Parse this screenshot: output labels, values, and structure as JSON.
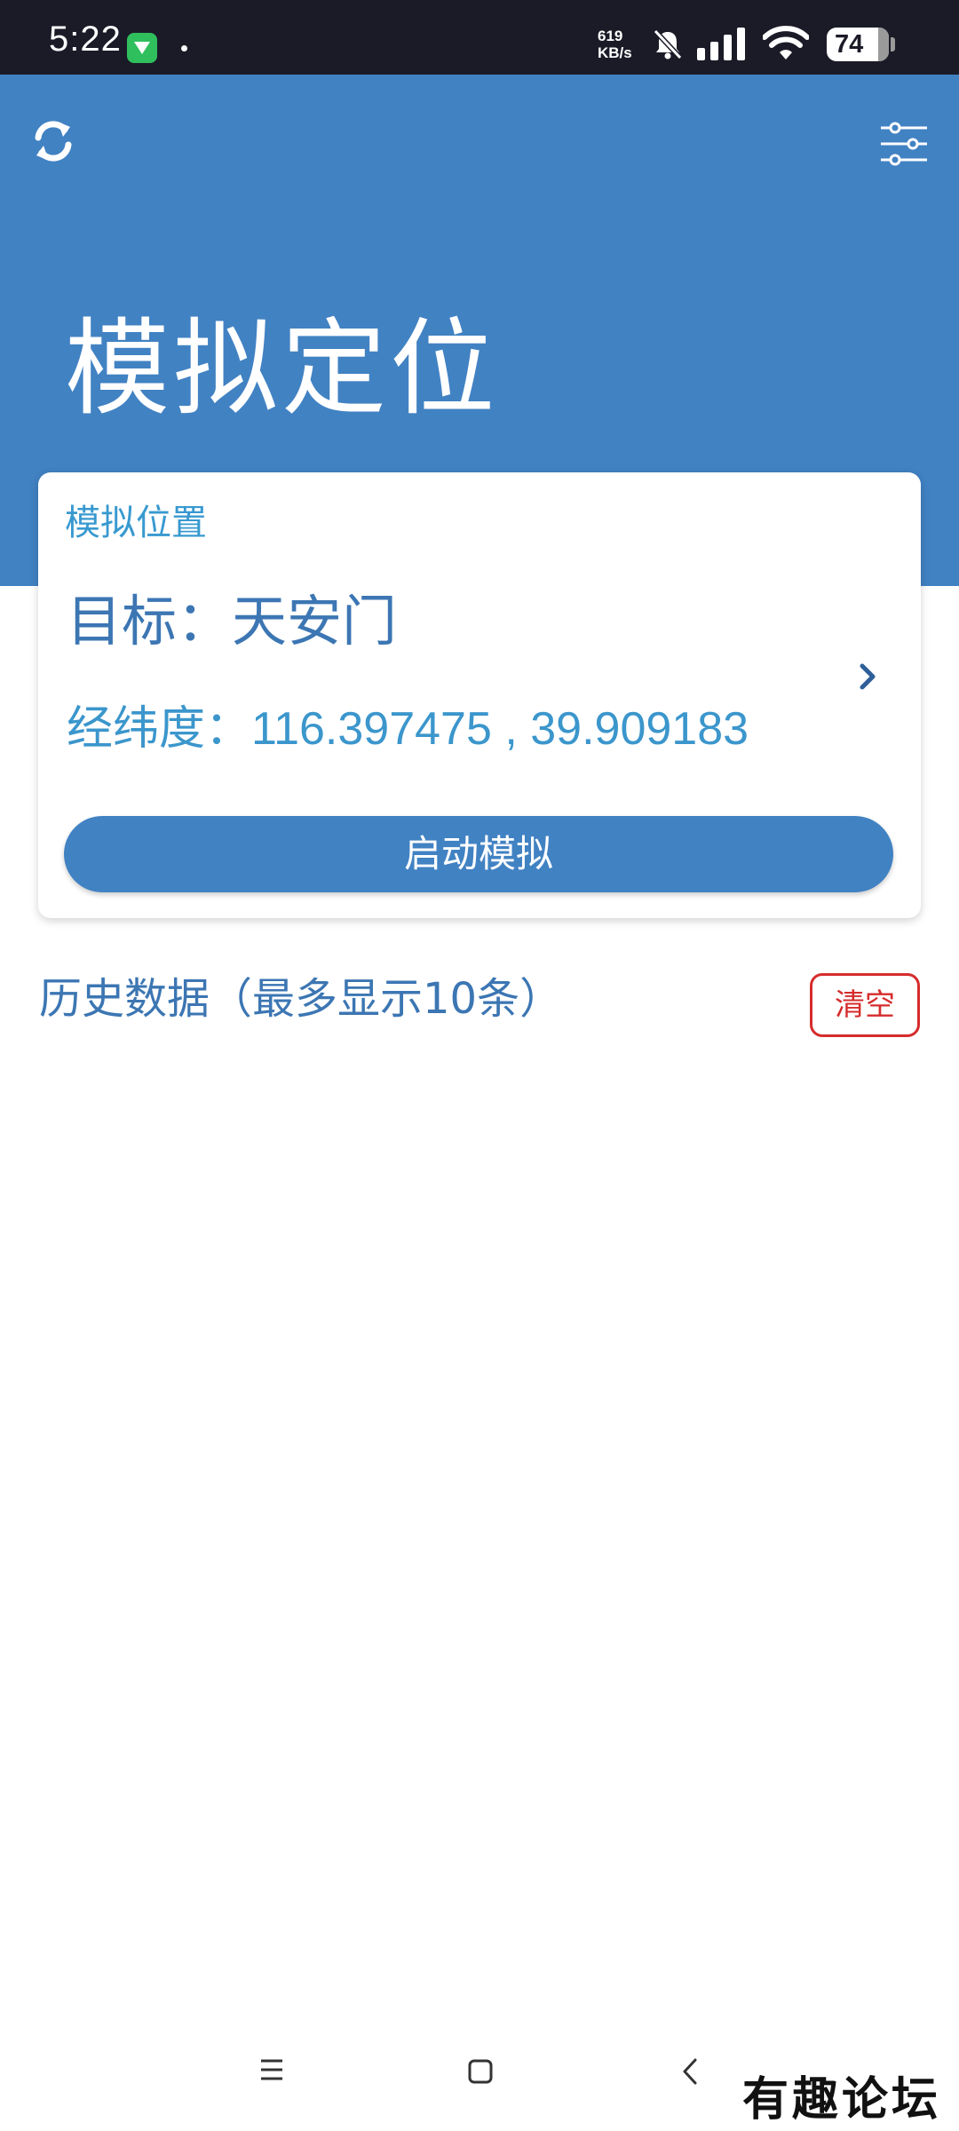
{
  "status_bar": {
    "time": "5:22",
    "net_speed_value": "619",
    "net_speed_unit": "KB/s",
    "battery": "74",
    "icons": [
      "app-notification-icon",
      "bell-muted-icon",
      "signal-icon",
      "wifi-icon",
      "battery-icon"
    ]
  },
  "header": {
    "title": "模拟定位",
    "refresh_icon": "refresh-icon",
    "filter_icon": "sliders-icon",
    "color": "#4182c3"
  },
  "card": {
    "title": "模拟位置",
    "target_label": "目标：",
    "target_value": "天安门",
    "coord_label": "经纬度：",
    "longitude": "116.397475",
    "separator": " , ",
    "latitude": "39.909183",
    "start_button": "启动模拟"
  },
  "history": {
    "title": "历史数据（最多显示10条）",
    "clear_button": "清空",
    "items": []
  },
  "nav_bar": {
    "icons": [
      "menu-icon",
      "home-icon",
      "back-icon"
    ]
  },
  "watermark": "有趣论坛"
}
